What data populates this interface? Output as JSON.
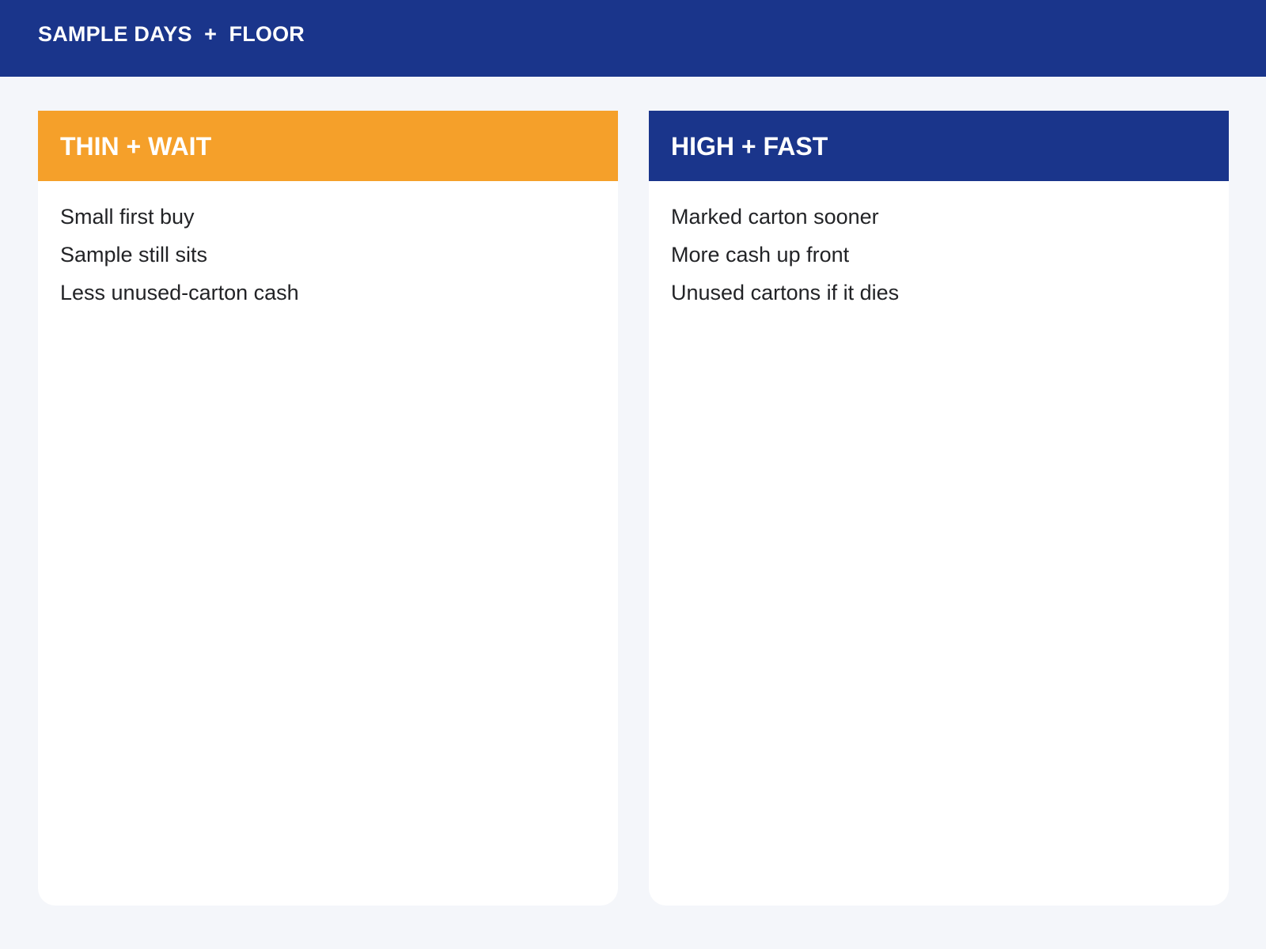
{
  "header": {
    "title": "SAMPLE DAYS  +  FLOOR",
    "background": "#1a358b"
  },
  "cards": [
    {
      "title": "THIN + WAIT",
      "header_color": "#f5a02a",
      "items": [
        "Small first buy",
        "Sample still sits",
        "Less unused-carton cash"
      ]
    },
    {
      "title": "HIGH + FAST",
      "header_color": "#1a358b",
      "items": [
        "Marked carton sooner",
        "More cash up front",
        "Unused cartons if it dies"
      ]
    }
  ]
}
